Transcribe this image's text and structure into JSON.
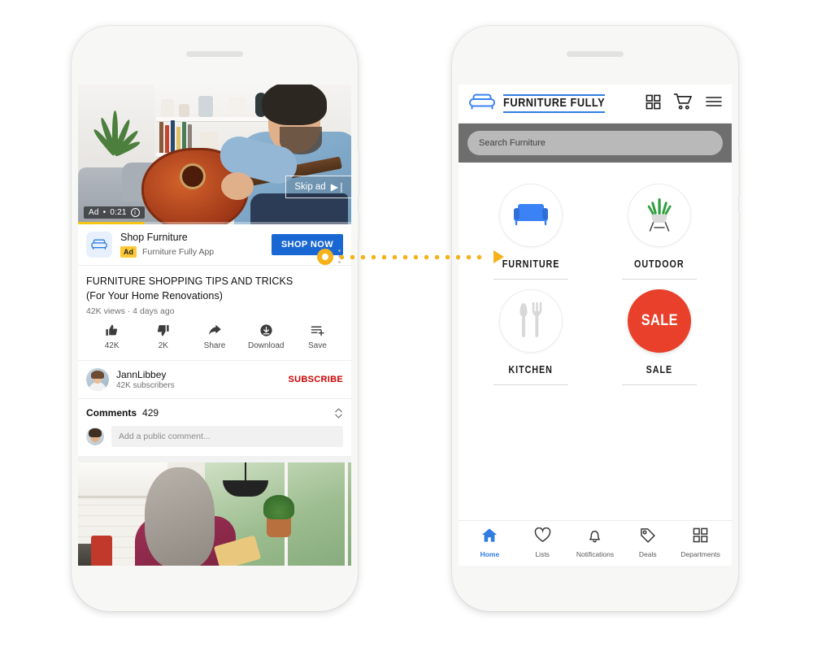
{
  "left_phone": {
    "video": {
      "ad_label": "Ad",
      "separator": "•",
      "duration": "0:21",
      "info_glyph": "i",
      "skip_label": "Skip ad",
      "skip_glyph": "▶❘"
    },
    "ad_banner": {
      "icon": "sofa-icon",
      "title": "Shop Furniture",
      "badge": "Ad",
      "advertiser": "Furniture Fully App",
      "cta": "SHOP NOW"
    },
    "video_info": {
      "title_line1": "FURNITURE SHOPPING TIPS AND TRICKS",
      "title_line2": "(For Your Home Renovations)",
      "stats": "42K views · 4 days ago",
      "actions": [
        {
          "icon": "thumbs-up-icon",
          "label": "42K"
        },
        {
          "icon": "thumbs-down-icon",
          "label": "2K"
        },
        {
          "icon": "share-icon",
          "label": "Share"
        },
        {
          "icon": "download-icon",
          "label": "Download"
        },
        {
          "icon": "save-icon",
          "label": "Save"
        }
      ]
    },
    "channel": {
      "name": "JannLibbey",
      "subscribers": "42K subscribers",
      "subscribe_label": "SUBSCRIBE"
    },
    "comments": {
      "title": "Comments",
      "count": "429",
      "input_placeholder": "Add a public comment..."
    }
  },
  "right_phone": {
    "header": {
      "logo": "sofa-logo-icon",
      "brand": "FURNITURE FULLY",
      "icons": [
        "grid-icon",
        "cart-icon",
        "hamburger-menu-icon"
      ]
    },
    "search": {
      "placeholder": "Search Furniture",
      "value": ""
    },
    "categories": [
      {
        "label": "FURNITURE",
        "icon": "sofa-icon"
      },
      {
        "label": "OUTDOOR",
        "icon": "potted-plant-icon"
      },
      {
        "label": "KITCHEN",
        "icon": "fork-knife-icon"
      },
      {
        "label": "SALE",
        "icon": "sale-badge-icon",
        "badge_text": "SALE"
      }
    ],
    "bottom_nav": [
      {
        "label": "Home",
        "icon": "home-icon",
        "active": true
      },
      {
        "label": "Lists",
        "icon": "heart-icon",
        "active": false
      },
      {
        "label": "Notifications",
        "icon": "bell-icon",
        "active": false
      },
      {
        "label": "Deals",
        "icon": "tag-icon",
        "active": false
      },
      {
        "label": "Departments",
        "icon": "grid-icon",
        "active": false
      }
    ]
  },
  "colors": {
    "ad_blue": "#1967d2",
    "brand_blue": "#2f7de1",
    "sale_red": "#e8402a",
    "subscribe_red": "#cc0000",
    "ad_badge_yellow": "#fcc934",
    "connector_orange": "#f6b21b",
    "search_band_gray": "#6e6e6e"
  }
}
